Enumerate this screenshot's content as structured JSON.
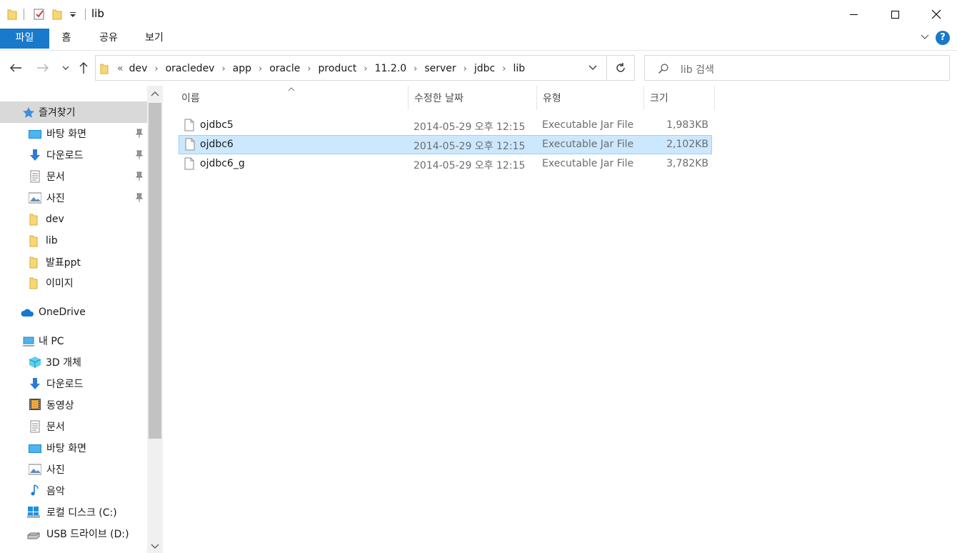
{
  "window": {
    "title": "lib"
  },
  "ribbon": {
    "tabs": [
      {
        "label": "파일"
      },
      {
        "label": "홈"
      },
      {
        "label": "공유"
      },
      {
        "label": "보기"
      }
    ],
    "help_label": "?"
  },
  "address": {
    "overflow": "«",
    "crumbs": [
      "dev",
      "oracledev",
      "app",
      "oracle",
      "product",
      "11.2.0",
      "server",
      "jdbc",
      "lib"
    ]
  },
  "search": {
    "placeholder": "lib 검색"
  },
  "nav": {
    "quick_access": {
      "label": "즐겨찾기",
      "items": [
        {
          "label": "바탕 화면",
          "icon": "desktop-icon",
          "pinned": true
        },
        {
          "label": "다운로드",
          "icon": "download-icon",
          "pinned": true
        },
        {
          "label": "문서",
          "icon": "document-icon",
          "pinned": true
        },
        {
          "label": "사진",
          "icon": "pictures-icon",
          "pinned": true
        },
        {
          "label": "dev",
          "icon": "folder-icon",
          "pinned": false
        },
        {
          "label": "lib",
          "icon": "folder-icon",
          "pinned": false
        },
        {
          "label": "발표ppt",
          "icon": "folder-icon",
          "pinned": false
        },
        {
          "label": "이미지",
          "icon": "folder-icon",
          "pinned": false
        }
      ]
    },
    "onedrive": {
      "label": "OneDrive"
    },
    "this_pc": {
      "label": "내 PC",
      "items": [
        {
          "label": "3D 개체",
          "icon": "3d-objects-icon"
        },
        {
          "label": "다운로드",
          "icon": "download-icon"
        },
        {
          "label": "동영상",
          "icon": "video-icon"
        },
        {
          "label": "문서",
          "icon": "document-icon"
        },
        {
          "label": "바탕 화면",
          "icon": "desktop-icon"
        },
        {
          "label": "사진",
          "icon": "pictures-icon"
        },
        {
          "label": "음악",
          "icon": "music-icon"
        },
        {
          "label": "로컬 디스크 (C:)",
          "icon": "local-disk-icon"
        },
        {
          "label": "USB 드라이브 (D:)",
          "icon": "usb-drive-icon"
        }
      ]
    }
  },
  "columns": {
    "name": "이름",
    "date": "수정한 날짜",
    "type": "유형",
    "size": "크기"
  },
  "files": [
    {
      "name": "ojdbc5",
      "date": "2014-05-29 오후 12:15",
      "type": "Executable Jar File",
      "size": "1,983KB",
      "selected": false
    },
    {
      "name": "ojdbc6",
      "date": "2014-05-29 오후 12:15",
      "type": "Executable Jar File",
      "size": "2,102KB",
      "selected": true
    },
    {
      "name": "ojdbc6_g",
      "date": "2014-05-29 오후 12:15",
      "type": "Executable Jar File",
      "size": "3,782KB",
      "selected": false
    }
  ],
  "colors": {
    "accent": "#1979ca",
    "selection": "#cce8ff",
    "selection_border": "#99d1ff",
    "folder": "#f8d775"
  }
}
